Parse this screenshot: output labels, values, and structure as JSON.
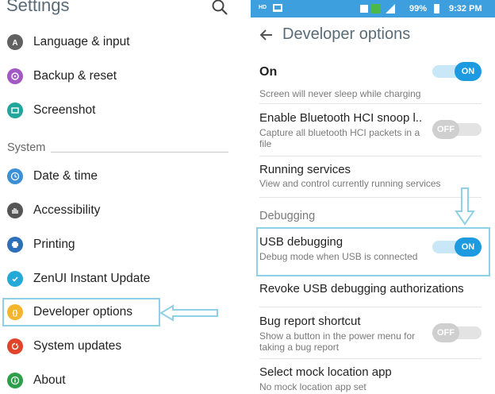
{
  "left": {
    "title": "Settings",
    "items_top": [
      {
        "label": "Language & input",
        "icon": "language-icon",
        "color": "#616161"
      },
      {
        "label": "Backup & reset",
        "icon": "backup-icon",
        "color": "#a259c4"
      },
      {
        "label": "Screenshot",
        "icon": "screenshot-icon",
        "color": "#21a69b"
      }
    ],
    "section": "System",
    "items_system": [
      {
        "label": "Date & time",
        "icon": "clock-icon",
        "color": "#3d8fd6"
      },
      {
        "label": "Accessibility",
        "icon": "hand-icon",
        "color": "#555555"
      },
      {
        "label": "Printing",
        "icon": "printer-icon",
        "color": "#2d6fb8"
      },
      {
        "label": "ZenUI Instant Update",
        "icon": "update-icon",
        "color": "#25a9d8"
      },
      {
        "label": "Developer options",
        "icon": "developer-icon",
        "color": "#f3b52c"
      },
      {
        "label": "System updates",
        "icon": "system-update-icon",
        "color": "#e0452b"
      },
      {
        "label": "About",
        "icon": "info-icon",
        "color": "#2e9e4a"
      }
    ]
  },
  "right": {
    "statusbar": {
      "left_badge": "HD",
      "battery": "99%",
      "time": "9:32 PM"
    },
    "title": "Developer options",
    "master": {
      "label": "On",
      "state": "ON"
    },
    "partial_sub": "Screen will never sleep while charging",
    "rows": {
      "bt_title": "Enable Bluetooth HCI snoop l..",
      "bt_sub": "Capture all bluetooth HCI packets in a file",
      "bt_toggle": "OFF",
      "rs_title": "Running services",
      "rs_sub": "View and control currently running services",
      "debugging_header": "Debugging",
      "usb_title": "USB debugging",
      "usb_sub": "Debug mode when USB is connected",
      "usb_toggle": "ON",
      "revoke_title": "Revoke USB debugging authorizations",
      "bug_title": "Bug report shortcut",
      "bug_sub": "Show a button in the power menu for taking a bug report",
      "bug_toggle": "OFF",
      "mock_title": "Select mock location app",
      "mock_sub": "No mock location app set"
    }
  },
  "colors": {
    "accent": "#1e9ae0",
    "statusbar": "#3d9fdd",
    "highlight": "#8fd0e6"
  }
}
